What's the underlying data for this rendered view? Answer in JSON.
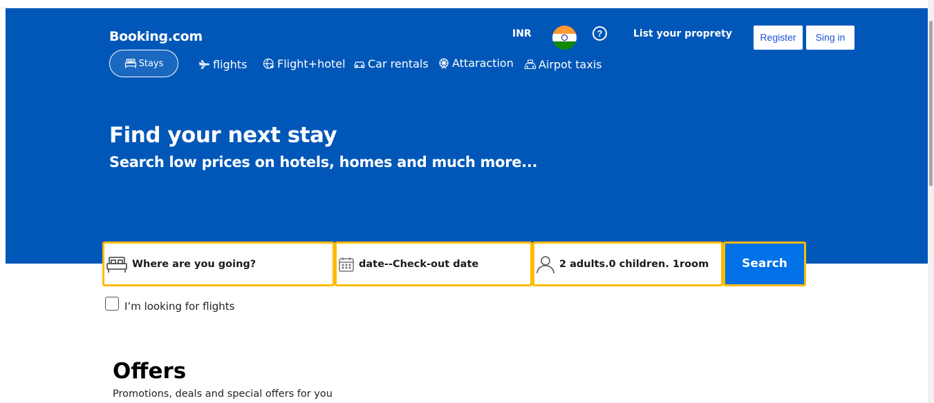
{
  "header": {
    "logo": "Booking.com",
    "currency": "INR",
    "flag_icon": "india-flag-icon",
    "help_glyph": "?",
    "list_property": "List your proprety",
    "register_label": "Register",
    "signin_label": "Sing in"
  },
  "nav": {
    "items": [
      {
        "label": "Stays",
        "icon": "bed-icon",
        "active": true
      },
      {
        "label": "flights",
        "icon": "plane-icon"
      },
      {
        "label": "Flight+hotel",
        "icon": "flight-hotel-icon"
      },
      {
        "label": "Car rentals",
        "icon": "car-icon"
      },
      {
        "label": "Attaraction",
        "icon": "ferris-wheel-icon"
      },
      {
        "label": "Airpot taxis",
        "icon": "taxi-icon"
      }
    ]
  },
  "hero": {
    "title": "Find your next stay",
    "subtitle": "Search low prices on hotels, homes and much more..."
  },
  "search": {
    "destination_placeholder": "Where are you going?",
    "dates_label": "date--Check-out date",
    "guests_label": "2 adults.0 children. 1room",
    "button_label": "Search",
    "flights_checkbox_label": "I’m looking for flights"
  },
  "offers": {
    "title": "Offers",
    "subtitle": "Promotions, deals and special offers for you"
  },
  "colors": {
    "brand_blue": "#0057b8",
    "search_button": "#0071e6",
    "field_border": "#febb02"
  }
}
